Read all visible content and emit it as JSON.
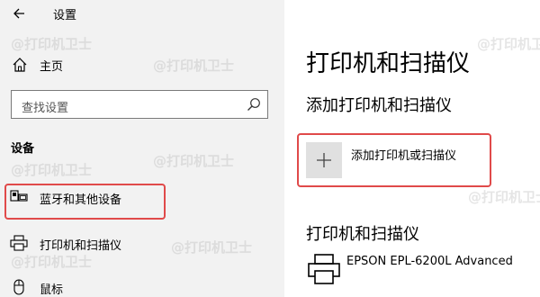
{
  "app": {
    "title": "设置"
  },
  "sidebar": {
    "home_label": "主页",
    "search": {
      "placeholder": "查找设置"
    },
    "section_header": "设备",
    "items": [
      {
        "label": "蓝牙和其他设备",
        "icon": "bluetooth-devices-icon",
        "selected": true
      },
      {
        "label": "打印机和扫描仪",
        "icon": "printer-icon",
        "selected": false
      },
      {
        "label": "鼠标",
        "icon": "mouse-icon",
        "selected": false
      }
    ]
  },
  "main": {
    "page_title": "打印机和扫描仪",
    "add_section_header": "添加打印机和扫描仪",
    "add_button_label": "添加打印机或扫描仪",
    "list_section_header": "打印机和扫描仪",
    "printers": [
      {
        "name": "EPSON EPL-6200L Advanced"
      }
    ]
  },
  "watermark": {
    "text": "@打印机卫士"
  },
  "colors": {
    "sidebar_bg": "#f2f2f2",
    "highlight_border": "#e04a4a",
    "add_button_bg": "#e0e0e0"
  }
}
